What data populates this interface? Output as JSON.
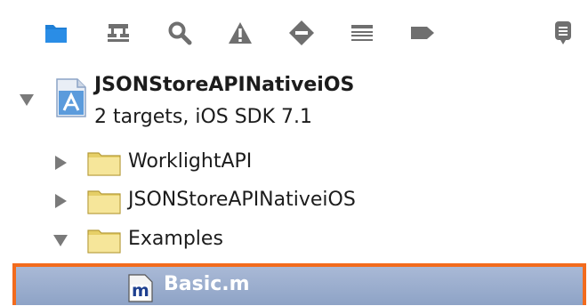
{
  "navigator_toolbar": {
    "icons": [
      "project-navigator-icon",
      "symbol-navigator-icon",
      "search-navigator-icon",
      "issue-navigator-icon",
      "test-navigator-icon",
      "debug-navigator-icon",
      "breakpoint-navigator-icon",
      "log-navigator-icon"
    ],
    "selected": "project-navigator-icon",
    "accent_color": "#1f7fd6"
  },
  "project": {
    "name": "JSONStoreAPINativeiOS",
    "subtitle": "2 targets, iOS SDK 7.1",
    "expanded": true
  },
  "items": [
    {
      "label": "WorklightAPI",
      "type": "folder",
      "expanded": false
    },
    {
      "label": "JSONStoreAPINativeiOS",
      "type": "folder",
      "expanded": false
    },
    {
      "label": "Examples",
      "type": "folder",
      "expanded": true
    }
  ],
  "selected_file": {
    "label": "Basic.m",
    "type": "m-file",
    "icon_letter": "m",
    "highlight_color": "#f26b1d"
  }
}
